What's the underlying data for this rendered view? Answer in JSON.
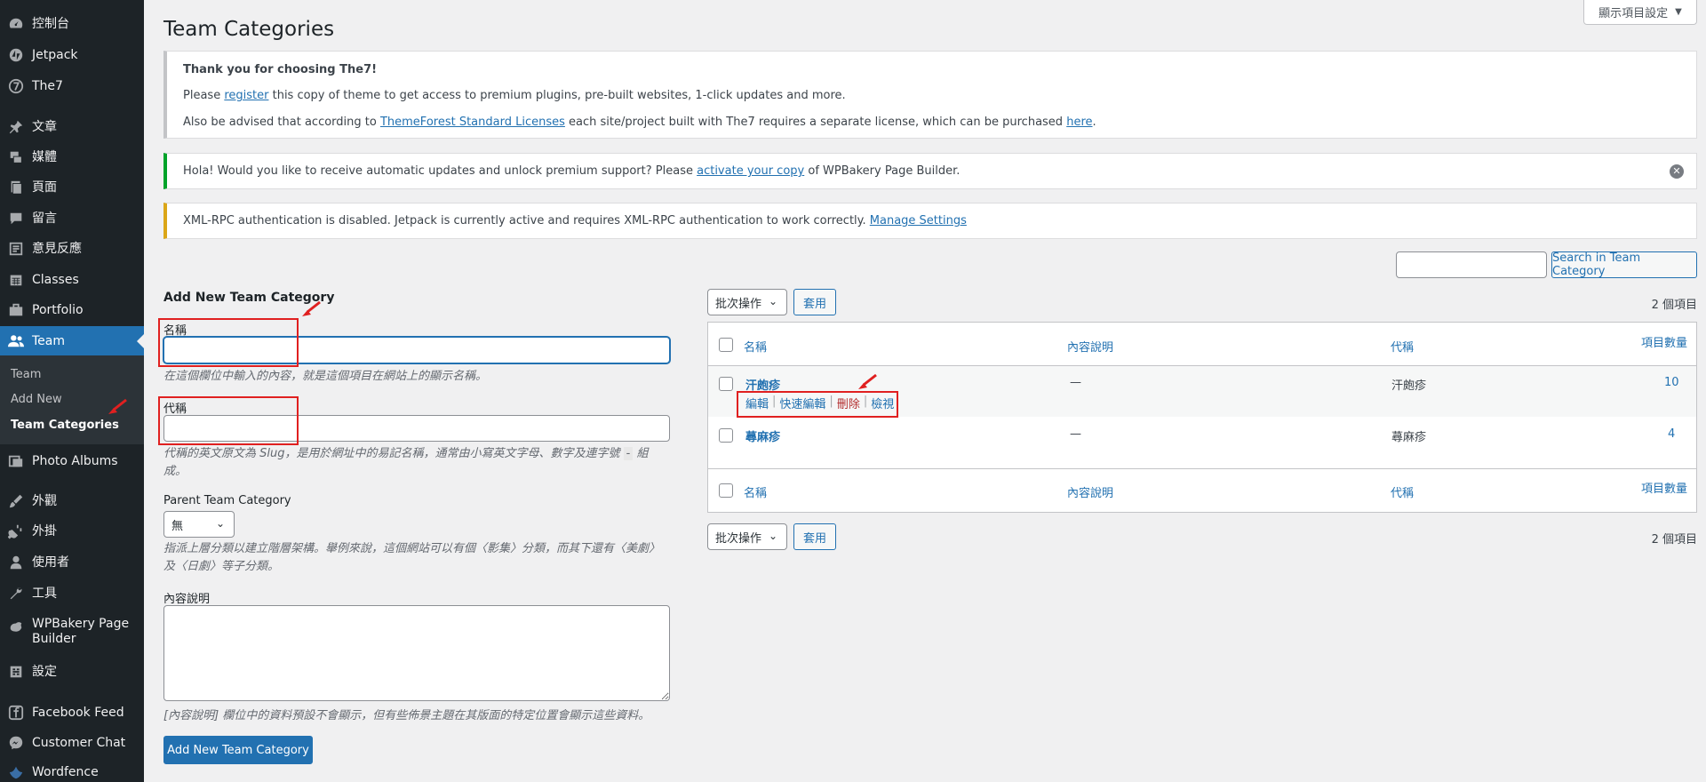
{
  "screen_options": {
    "label": "顯示項目設定"
  },
  "page_title": "Team Categories",
  "sidebar": {
    "items": [
      {
        "label": "控制台",
        "icon": "dashboard-icon"
      },
      {
        "label": "Jetpack",
        "icon": "jetpack-icon"
      },
      {
        "label": "The7",
        "icon": "the7-icon"
      },
      {
        "label": "文章",
        "icon": "pin-icon"
      },
      {
        "label": "媒體",
        "icon": "media-icon"
      },
      {
        "label": "頁面",
        "icon": "page-icon"
      },
      {
        "label": "留言",
        "icon": "comment-icon"
      },
      {
        "label": "意見反應",
        "icon": "feedback-icon"
      },
      {
        "label": "Classes",
        "icon": "calendar-icon"
      },
      {
        "label": "Portfolio",
        "icon": "portfolio-icon"
      },
      {
        "label": "Team",
        "icon": "users-icon"
      },
      {
        "label": "Photo Albums",
        "icon": "photo-albums-icon"
      },
      {
        "label": "外觀",
        "icon": "brush-icon"
      },
      {
        "label": "外掛",
        "icon": "plugin-icon"
      },
      {
        "label": "使用者",
        "icon": "user-icon"
      },
      {
        "label": "工具",
        "icon": "wrench-icon"
      },
      {
        "label": "WPBakery Page Builder",
        "icon": "wpbakery-icon"
      },
      {
        "label": "設定",
        "icon": "settings-icon"
      },
      {
        "label": "Facebook Feed",
        "icon": "facebook-icon"
      },
      {
        "label": "Customer Chat",
        "icon": "messenger-icon"
      },
      {
        "label": "Wordfence",
        "icon": "wordfence-icon"
      }
    ],
    "submenu": [
      {
        "label": "Team"
      },
      {
        "label": "Add New"
      },
      {
        "label": "Team Categories"
      }
    ]
  },
  "notices": {
    "the7": {
      "heading": "Thank you for choosing The7!",
      "line2_pre": "Please ",
      "line2_link": "register",
      "line2_post": " this copy of theme to get access to premium plugins, pre-built websites, 1-click updates and more.",
      "line3_pre": "Also be advised that according to ",
      "line3_link": "ThemeForest Standard Licenses",
      "line3_mid": " each site/project built with The7 requires a separate license, which can be purchased ",
      "line3_link2": "here",
      "line3_end": "."
    },
    "wpb": {
      "pre": "Hola! Would you like to receive automatic updates and unlock premium support? Please ",
      "link": "activate your copy",
      "post": " of WPBakery Page Builder."
    },
    "xml": {
      "pre": "XML-RPC authentication is disabled. Jetpack is currently active and requires XML-RPC authentication to work correctly. ",
      "link": "Manage Settings"
    }
  },
  "search": {
    "button": "Search in Team Category",
    "value": ""
  },
  "form": {
    "heading": "Add New Team Category",
    "name_label": "名稱",
    "name_help": "在這個欄位中輸入的內容，就是這個項目在網站上的顯示名稱。",
    "slug_label": "代稱",
    "slug_help_1": "代稱的英文原文為 Slug，是用於網址中的易記名稱，通常由小寫英文字母、數字及連字號",
    "slug_help_dash": "-",
    "slug_help_2": "組",
    "slug_help_3": "成。",
    "parent_label": "Parent Team Category",
    "parent_value": "無",
    "parent_help_1": "指派上層分類以建立階層架構。舉例來說，這個網站可以有個〈影集〉分類，而其下還有〈美劇〉",
    "parent_help_2": "及〈日劇〉等子分類。",
    "desc_label": "內容說明",
    "desc_help": "[內容說明] 欄位中的資料預設不會顯示，但有些佈景主題在其版面的特定位置會顯示這些資料。",
    "submit": "Add New Team Category"
  },
  "table": {
    "bulk_label": "批次操作",
    "apply": "套用",
    "count": "2 個項目",
    "columns": {
      "name": "名稱",
      "desc": "內容說明",
      "slug": "代稱",
      "count": "項目數量"
    },
    "rows": [
      {
        "name": "汗皰疹",
        "desc": "—",
        "slug": "汗皰疹",
        "count": "10"
      },
      {
        "name": "蕁麻疹",
        "desc": "—",
        "slug": "蕁麻疹",
        "count": "4"
      }
    ],
    "row_actions": {
      "edit": "編輯",
      "quick_edit": "快速編輯",
      "delete": "刪除",
      "view": "檢視",
      "sep": "|"
    }
  },
  "colors": {
    "admin_blue": "#2271b1",
    "sidebar_bg": "#1d2327",
    "annotation_red": "#e02020",
    "notice_green": "#00a32a",
    "notice_yellow": "#dba617"
  }
}
